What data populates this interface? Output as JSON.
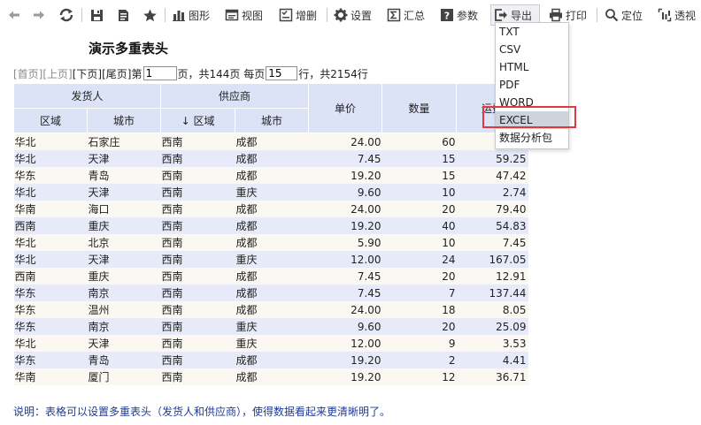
{
  "toolbar": {
    "icons": [
      "arrow-left-icon",
      "arrow-right-icon",
      "refresh-icon",
      "save-icon",
      "doc-icon",
      "star-icon"
    ],
    "buttons": [
      {
        "name": "chart",
        "label": "图形"
      },
      {
        "name": "view",
        "label": "视图"
      },
      {
        "name": "add-delete",
        "label": "增删"
      },
      {
        "name": "settings",
        "label": "设置"
      },
      {
        "name": "summary",
        "label": "汇总"
      },
      {
        "name": "params",
        "label": "参数"
      },
      {
        "name": "export",
        "label": "导出"
      },
      {
        "name": "print",
        "label": "打印"
      },
      {
        "name": "locate",
        "label": "定位"
      },
      {
        "name": "pivot",
        "label": "透视"
      }
    ]
  },
  "title": "演示多重表头",
  "pager": {
    "first": "[首页]",
    "prev": "[上页]",
    "next": "[下页]",
    "last": "[尾页]",
    "page_prefix": "第",
    "current_page": "1",
    "page_suffix": "页，共144页 每页",
    "page_size": "15",
    "rows_suffix": "行，共2154行"
  },
  "table": {
    "group_headers": {
      "sender": "发货人",
      "supplier": "供应商"
    },
    "sub_headers": {
      "sender_region": "区域",
      "sender_city": "城市",
      "supplier_region": "区域",
      "supplier_city": "城市"
    },
    "sort_arrow": "↓",
    "headers": {
      "price": "单价",
      "qty": "数量",
      "freight": "运费"
    },
    "rows": [
      {
        "sr": "华北",
        "sc": "石家庄",
        "pr": "西南",
        "pc": "成都",
        "price": "24.00",
        "qty": "60",
        "freight": ""
      },
      {
        "sr": "华北",
        "sc": "天津",
        "pr": "西南",
        "pc": "成都",
        "price": "7.45",
        "qty": "15",
        "freight": "59.25"
      },
      {
        "sr": "华东",
        "sc": "青岛",
        "pr": "西南",
        "pc": "成都",
        "price": "19.20",
        "qty": "15",
        "freight": "47.42"
      },
      {
        "sr": "华北",
        "sc": "天津",
        "pr": "西南",
        "pc": "重庆",
        "price": "9.60",
        "qty": "10",
        "freight": "2.74"
      },
      {
        "sr": "华南",
        "sc": "海口",
        "pr": "西南",
        "pc": "成都",
        "price": "24.00",
        "qty": "20",
        "freight": "79.40"
      },
      {
        "sr": "西南",
        "sc": "重庆",
        "pr": "西南",
        "pc": "成都",
        "price": "19.20",
        "qty": "40",
        "freight": "54.83"
      },
      {
        "sr": "华北",
        "sc": "北京",
        "pr": "西南",
        "pc": "成都",
        "price": "5.90",
        "qty": "10",
        "freight": "7.45"
      },
      {
        "sr": "华北",
        "sc": "天津",
        "pr": "西南",
        "pc": "重庆",
        "price": "12.00",
        "qty": "24",
        "freight": "167.05"
      },
      {
        "sr": "西南",
        "sc": "重庆",
        "pr": "西南",
        "pc": "成都",
        "price": "7.45",
        "qty": "20",
        "freight": "12.91"
      },
      {
        "sr": "华东",
        "sc": "南京",
        "pr": "西南",
        "pc": "成都",
        "price": "7.45",
        "qty": "7",
        "freight": "137.44"
      },
      {
        "sr": "华东",
        "sc": "温州",
        "pr": "西南",
        "pc": "成都",
        "price": "24.00",
        "qty": "18",
        "freight": "8.05"
      },
      {
        "sr": "华东",
        "sc": "南京",
        "pr": "西南",
        "pc": "重庆",
        "price": "9.60",
        "qty": "20",
        "freight": "25.09"
      },
      {
        "sr": "华北",
        "sc": "天津",
        "pr": "西南",
        "pc": "重庆",
        "price": "12.00",
        "qty": "9",
        "freight": "3.53"
      },
      {
        "sr": "华东",
        "sc": "青岛",
        "pr": "西南",
        "pc": "成都",
        "price": "19.20",
        "qty": "2",
        "freight": "4.41"
      },
      {
        "sr": "华南",
        "sc": "厦门",
        "pr": "西南",
        "pc": "成都",
        "price": "19.20",
        "qty": "12",
        "freight": "36.71"
      }
    ]
  },
  "export_menu": {
    "items": [
      "TXT",
      "CSV",
      "HTML",
      "PDF",
      "WORD",
      "EXCEL",
      "数据分析包"
    ],
    "selected": "EXCEL"
  },
  "note": "说明：表格可以设置多重表头（发货人和供应商），使得数据看起来更清晰明了。",
  "colors": {
    "header_bg": "#dde3f7",
    "row_odd": "#fbf8f1",
    "row_even": "#e7ebf9",
    "highlight": "#e0383e",
    "note": "#1f3a93"
  }
}
